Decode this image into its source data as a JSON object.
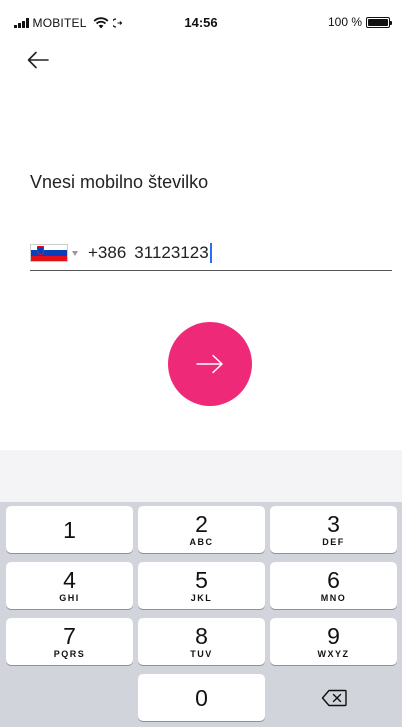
{
  "status_bar": {
    "carrier": "MOBITEL",
    "time": "14:56",
    "battery_text": "100 %",
    "battery_level_percent": 100
  },
  "header": {
    "back_icon": "arrow-left-icon"
  },
  "form": {
    "title": "Vnesi mobilno številko",
    "country_flag": "slovenia-flag",
    "country_code": "+386",
    "phone_value": "31123123"
  },
  "next_button": {
    "icon": "arrow-right-icon",
    "color": "#ee2a78"
  },
  "keyboard": {
    "keys": [
      {
        "digit": "1",
        "letters": ""
      },
      {
        "digit": "2",
        "letters": "ABC"
      },
      {
        "digit": "3",
        "letters": "DEF"
      },
      {
        "digit": "4",
        "letters": "GHI"
      },
      {
        "digit": "5",
        "letters": "JKL"
      },
      {
        "digit": "6",
        "letters": "MNO"
      },
      {
        "digit": "7",
        "letters": "PQRS"
      },
      {
        "digit": "8",
        "letters": "TUV"
      },
      {
        "digit": "9",
        "letters": "WXYZ"
      },
      {
        "digit": "0",
        "letters": ""
      }
    ],
    "backspace_icon": "backspace-icon"
  }
}
